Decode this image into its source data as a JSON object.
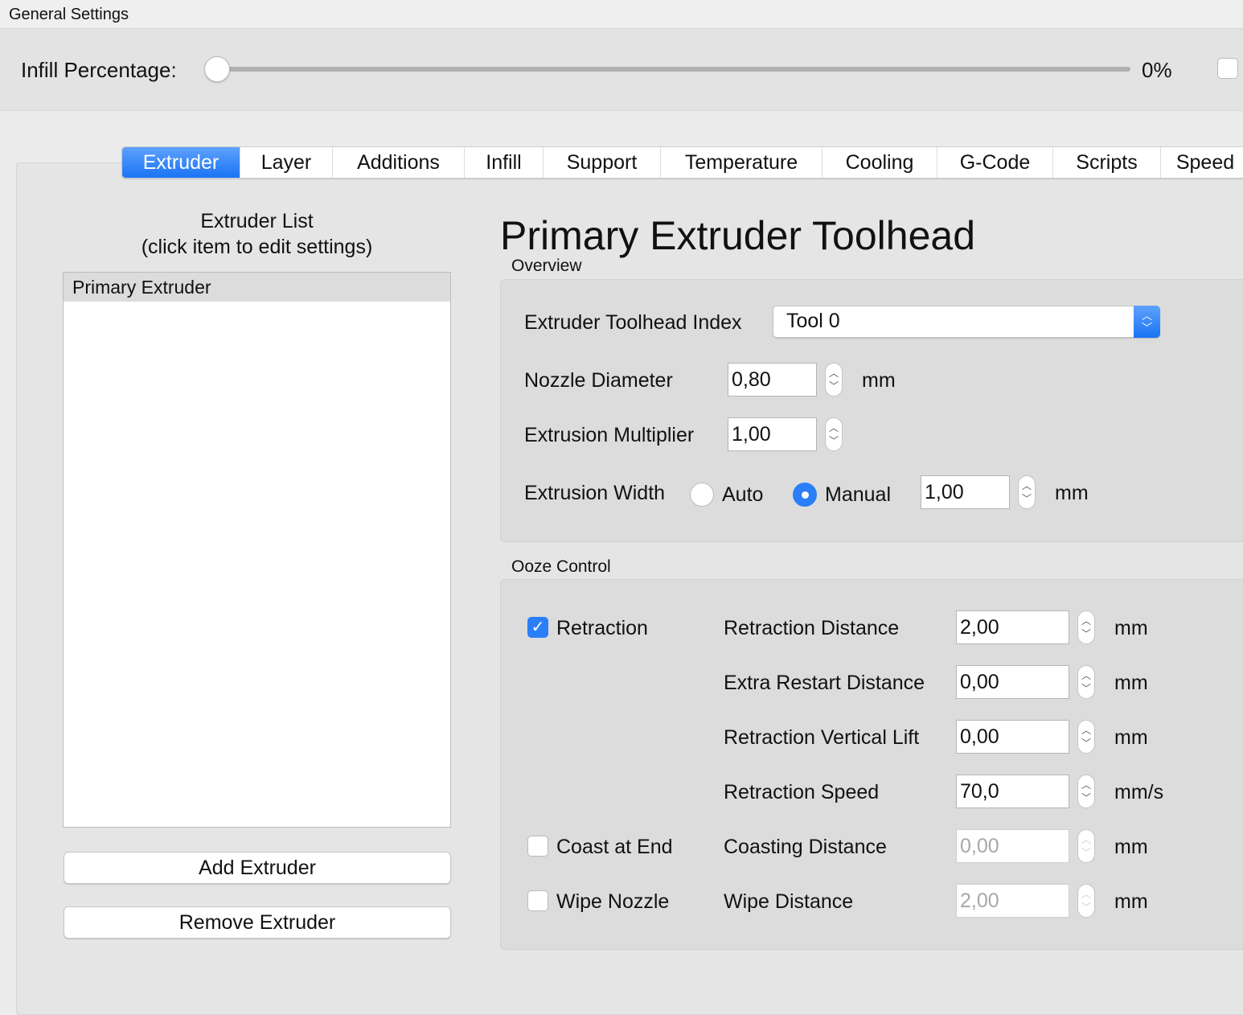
{
  "window": {
    "title": "General Settings"
  },
  "infill": {
    "label": "Infill Percentage:",
    "value_text": "0%",
    "value": 0
  },
  "tabs": [
    "Extruder",
    "Layer",
    "Additions",
    "Infill",
    "Support",
    "Temperature",
    "Cooling",
    "G-Code",
    "Scripts",
    "Speed"
  ],
  "active_tab": "Extruder",
  "extruder_list": {
    "title": "Extruder List",
    "subtitle": "(click item to edit settings)",
    "items": [
      "Primary Extruder"
    ],
    "add_label": "Add Extruder",
    "remove_label": "Remove Extruder"
  },
  "heading": "Primary Extruder Toolhead",
  "overview": {
    "title": "Overview",
    "toolhead_label": "Extruder Toolhead Index",
    "toolhead_value": "Tool 0",
    "nozzle_label": "Nozzle Diameter",
    "nozzle_value": "0,80",
    "nozzle_unit": "mm",
    "mult_label": "Extrusion Multiplier",
    "mult_value": "1,00",
    "width_label": "Extrusion Width",
    "auto_label": "Auto",
    "manual_label": "Manual",
    "width_mode": "Manual",
    "width_value": "1,00",
    "width_unit": "mm"
  },
  "ooze": {
    "title": "Ooze Control",
    "retraction_label": "Retraction",
    "retraction_checked": true,
    "coast_label": "Coast at End",
    "coast_checked": false,
    "wipe_label": "Wipe Nozzle",
    "wipe_checked": false,
    "rows": [
      {
        "label": "Retraction Distance",
        "value": "2,00",
        "unit": "mm"
      },
      {
        "label": "Extra Restart Distance",
        "value": "0,00",
        "unit": "mm"
      },
      {
        "label": "Retraction Vertical Lift",
        "value": "0,00",
        "unit": "mm"
      },
      {
        "label": "Retraction Speed",
        "value": "70,0",
        "unit": "mm/s"
      },
      {
        "label": "Coasting Distance",
        "value": "0,00",
        "unit": "mm"
      },
      {
        "label": "Wipe Distance",
        "value": "2,00",
        "unit": "mm"
      }
    ]
  },
  "colors": {
    "accent": "#1a74f5"
  }
}
